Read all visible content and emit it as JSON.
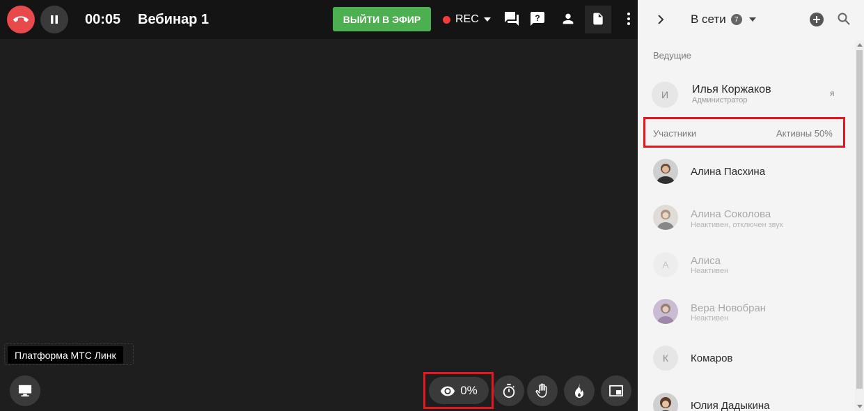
{
  "header": {
    "timer": "00:05",
    "title": "Вебинар 1",
    "live_button": "ВЫЙТИ В ЭФИР",
    "rec_label": "REC"
  },
  "stage": {
    "platform_tooltip": "Платформа МТС Линк",
    "attention_percent": "0%"
  },
  "panel": {
    "title": "В сети",
    "online_count": "7",
    "hosts_label": "Ведущие",
    "participants_label": "Участники",
    "active_label": "Активны 50%",
    "hosts": [
      {
        "initial": "И",
        "name": "Илья Коржаков",
        "sub": "Администратор",
        "me": "я"
      }
    ],
    "participants": [
      {
        "name": "Алина Пасхина",
        "sub": "",
        "status": "active"
      },
      {
        "name": "Алина Соколова",
        "sub": "Неактивен, отключен звук",
        "status": "inactive"
      },
      {
        "initial": "А",
        "name": "Алиса",
        "sub": "Неактивен",
        "status": "inactive"
      },
      {
        "name": "Вера Новобран",
        "sub": "Неактивен",
        "status": "inactive"
      },
      {
        "initial": "К",
        "name": "Комаров",
        "sub": "",
        "status": "active"
      },
      {
        "name": "Юлия Дадыкина",
        "sub": "",
        "status": "active"
      }
    ]
  },
  "colors": {
    "hangup": "#e8494a",
    "live": "#4caf50",
    "rec_dot": "#f23c3c",
    "highlight": "#e8161e"
  }
}
